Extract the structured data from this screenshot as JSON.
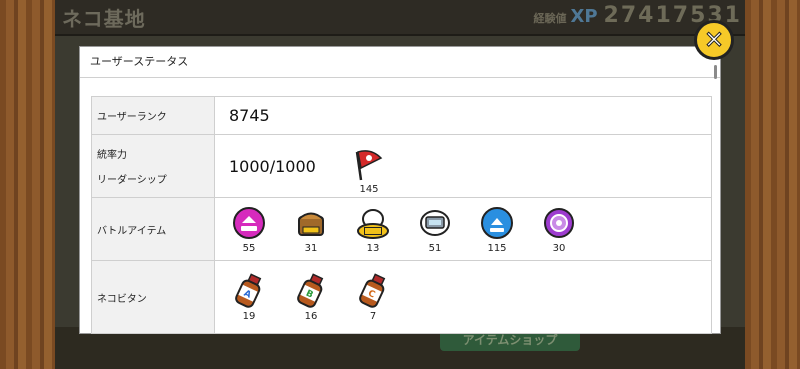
{
  "background": {
    "title": "ネコ基地",
    "xp_label": "経験値",
    "xp_badge": "XP",
    "xp_value": "27417531",
    "shop_button": "アイテムショップ"
  },
  "dialog": {
    "title": "ユーザーステータス",
    "rows": {
      "user_rank": {
        "label": "ユーザーランク",
        "value": "8745"
      },
      "leadership": {
        "label1": "統率力",
        "label2": "リーダーシップ",
        "value": "1000/1000",
        "flag_count": "145"
      },
      "battle_items": {
        "label": "バトルアイテム",
        "items": [
          {
            "icon": "speed-up-icon",
            "count": "55"
          },
          {
            "icon": "treasure-radar-icon",
            "count": "31"
          },
          {
            "icon": "rich-cat-max-icon",
            "count": "13"
          },
          {
            "icon": "cat-cpu-icon",
            "count": "51"
          },
          {
            "icon": "xp-up-icon",
            "count": "115"
          },
          {
            "icon": "sniper-icon",
            "count": "30"
          }
        ]
      },
      "neko_vitan": {
        "label": "ネコビタン",
        "items": [
          {
            "icon": "vitan-a-icon",
            "letter": "A",
            "count": "19"
          },
          {
            "icon": "vitan-b-icon",
            "letter": "B",
            "count": "16"
          },
          {
            "icon": "vitan-c-icon",
            "letter": "C",
            "count": "7"
          }
        ]
      }
    }
  },
  "colors": {
    "close_button": "#f6c928",
    "flag": "#d42a2a"
  }
}
